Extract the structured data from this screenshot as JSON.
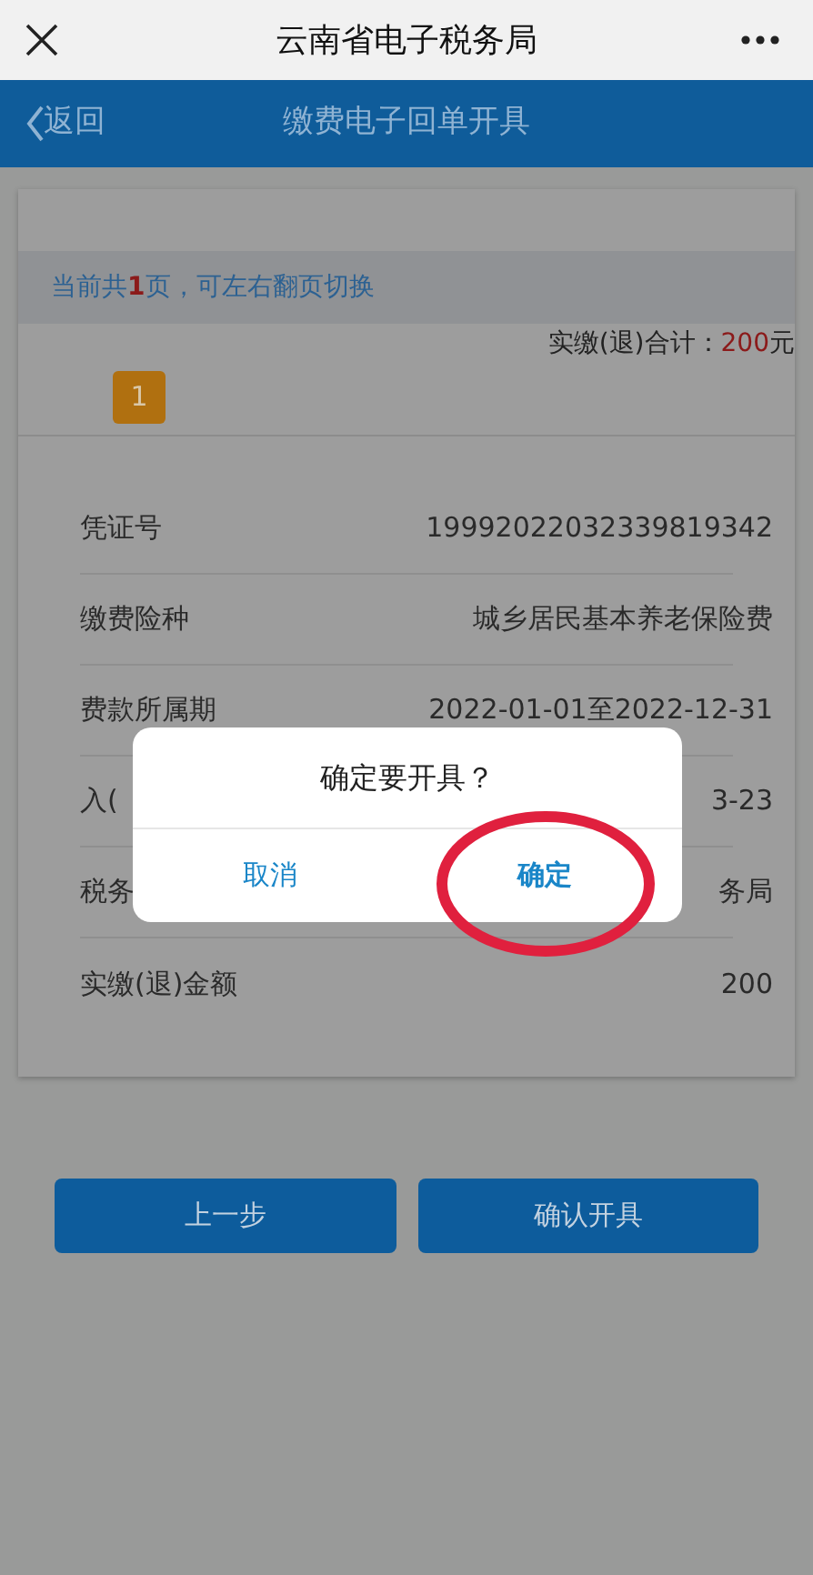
{
  "top_bar": {
    "title": "云南省电子税务局"
  },
  "header": {
    "back": "返回",
    "title": "缴费电子回单开具"
  },
  "page_hint": "当前共**1**页，可左右翻页切换",
  "total": {
    "label": "实缴(退)合计：",
    "amount": "200",
    "unit": "元"
  },
  "pages": [
    {
      "label": "1",
      "selected": true
    }
  ],
  "rows": [
    {
      "label": "凭证号",
      "value": "19992022032339819342"
    },
    {
      "label": "缴费险种",
      "value": "城乡居民基本养老保险费"
    },
    {
      "label": "费款所属期",
      "value": "2022-01-01至2022-12-31"
    },
    {
      "label": "入(",
      "value": "3-23"
    },
    {
      "label": "税务",
      "value": "务局"
    },
    {
      "label": "实缴(退)金额",
      "value": "200"
    }
  ],
  "footer_buttons": [
    "上一步",
    "确认开具"
  ],
  "dialog": {
    "message": "确定要开具？",
    "buttons": [
      {
        "label": "取消",
        "highlighted": false
      },
      {
        "label": "确定",
        "highlighted": true
      }
    ]
  }
}
